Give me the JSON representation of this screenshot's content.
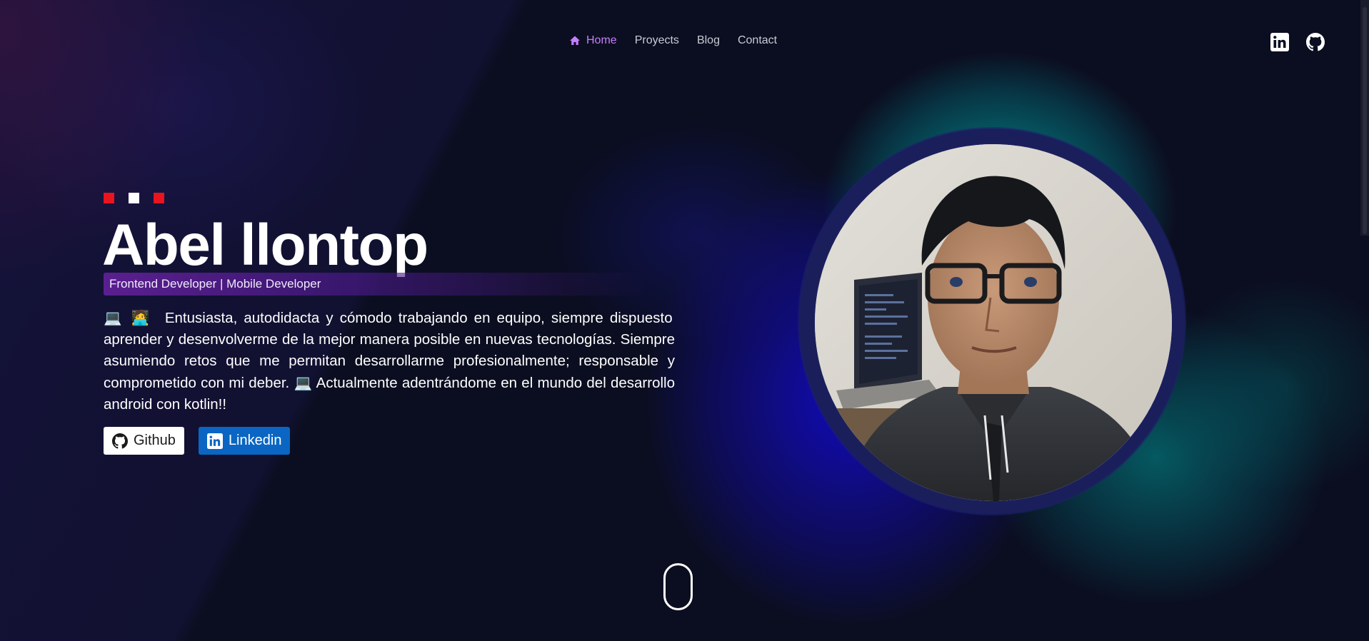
{
  "nav": {
    "items": [
      {
        "label": "Home",
        "icon": "home-icon",
        "active": true
      },
      {
        "label": "Proyects"
      },
      {
        "label": "Blog"
      },
      {
        "label": "Contact"
      }
    ]
  },
  "social": {
    "icons": [
      "linkedin-icon",
      "github-icon"
    ]
  },
  "hero": {
    "name": "Abel llontop",
    "role": "Frontend Developer | Mobile Developer",
    "bio": "Entusiasta, autodidacta y cómodo trabajando en equipo, siempre dispuesto aprender y desenvolverme de la mejor manera posible en nuevas tecnologías. Siempre asumiendo retos que me permitan desarrollarme profesionalmente; responsable y comprometido con mi deber.",
    "bio_emoji_start": "💻 🧑‍💻",
    "bio_emoji_mid": "💻",
    "bio_tail": "Actualmente adentrándome en el mundo del desarrollo android con kotlin!!",
    "buttons": {
      "github": "Github",
      "linkedin": "Linkedin"
    }
  },
  "colors": {
    "accent": "#c77dff",
    "dot_red": "#e8141e",
    "dot_white": "#ffffff",
    "linkedin_blue": "#0a66c2",
    "background": "#0b0e20"
  }
}
